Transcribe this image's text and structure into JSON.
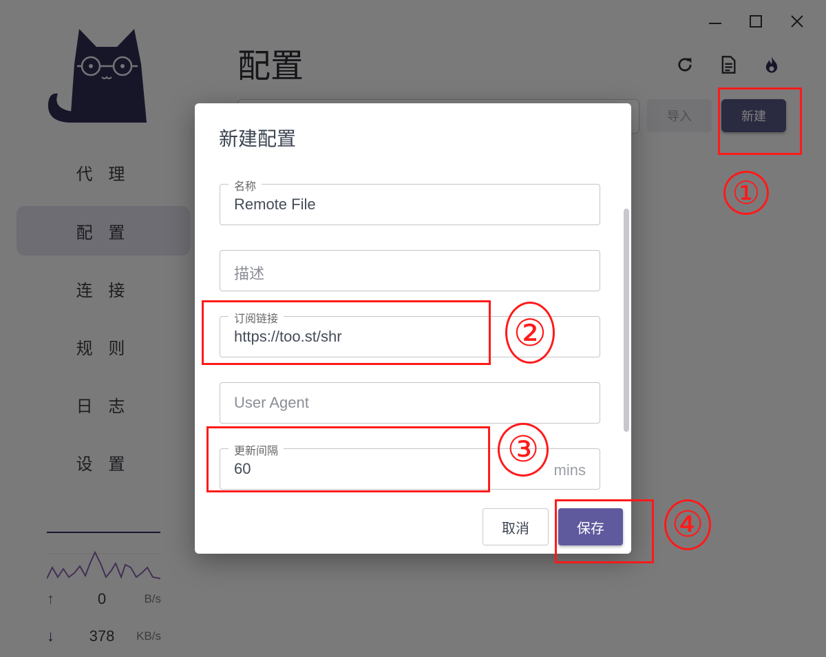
{
  "window": {
    "controls": {
      "minimize": "minimize-icon",
      "maximize": "maximize-icon",
      "close": "close-icon"
    }
  },
  "sidebar": {
    "items": [
      {
        "label": "代 理"
      },
      {
        "label": "配 置",
        "active": true
      },
      {
        "label": "连 接"
      },
      {
        "label": "规 则"
      },
      {
        "label": "日 志"
      },
      {
        "label": "设 置"
      }
    ],
    "traffic": {
      "upload": {
        "value": "0",
        "unit": "B/s"
      },
      "download": {
        "value": "378",
        "unit": "KB/s"
      }
    }
  },
  "header": {
    "title": "配置",
    "icons": [
      "refresh-icon",
      "document-icon",
      "fire-icon"
    ],
    "import_label": "导入",
    "new_label": "新建"
  },
  "dialog": {
    "title": "新建配置",
    "fields": {
      "name": {
        "label": "名称",
        "value": "Remote File"
      },
      "desc": {
        "placeholder": "描述"
      },
      "url": {
        "label": "订阅链接",
        "value": "https://too.st/shr"
      },
      "ua": {
        "placeholder": "User Agent"
      },
      "interval": {
        "label": "更新间隔",
        "value": "60",
        "suffix": "mins"
      }
    },
    "cancel_label": "取消",
    "save_label": "保存"
  },
  "annotations": {
    "color": "#ff1a1a",
    "steps": [
      "①",
      "②",
      "③",
      "④"
    ]
  }
}
